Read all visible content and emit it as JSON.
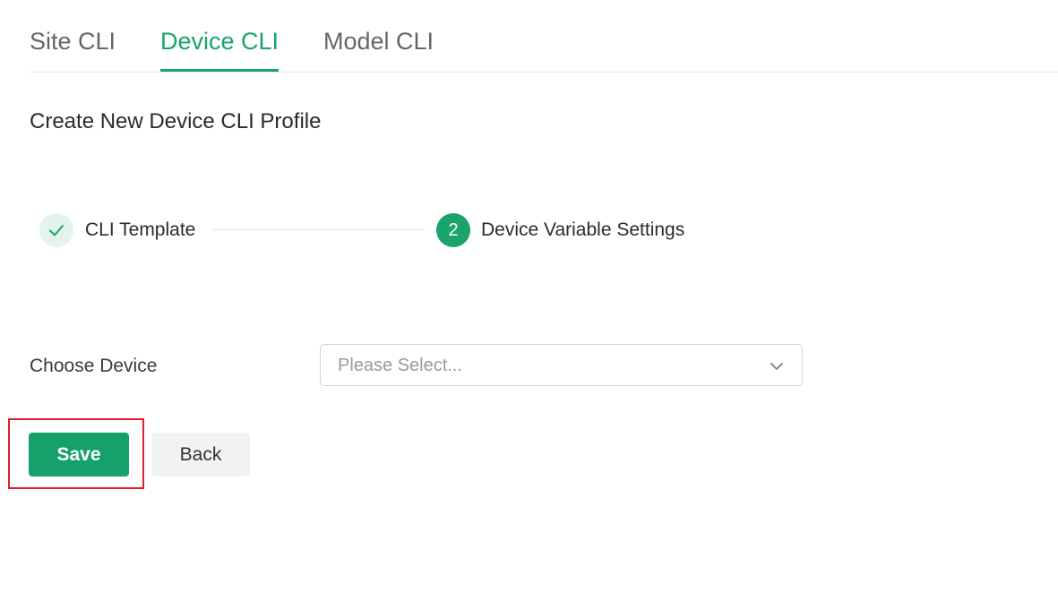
{
  "tabs": [
    {
      "label": "Site CLI",
      "active": false
    },
    {
      "label": "Device CLI",
      "active": true
    },
    {
      "label": "Model CLI",
      "active": false
    }
  ],
  "page": {
    "title": "Create New Device CLI Profile"
  },
  "steps": [
    {
      "label": "CLI Template",
      "status": "done",
      "icon": "check-icon"
    },
    {
      "label": "Device Variable Settings",
      "status": "active",
      "number": "2"
    }
  ],
  "form": {
    "device_label": "Choose Device",
    "device_placeholder": "Please Select...",
    "chevron_icon": "chevron-down-icon"
  },
  "actions": {
    "save_label": "Save",
    "back_label": "Back"
  },
  "colors": {
    "accent": "#1aa36b",
    "highlight": "#e0202a"
  }
}
